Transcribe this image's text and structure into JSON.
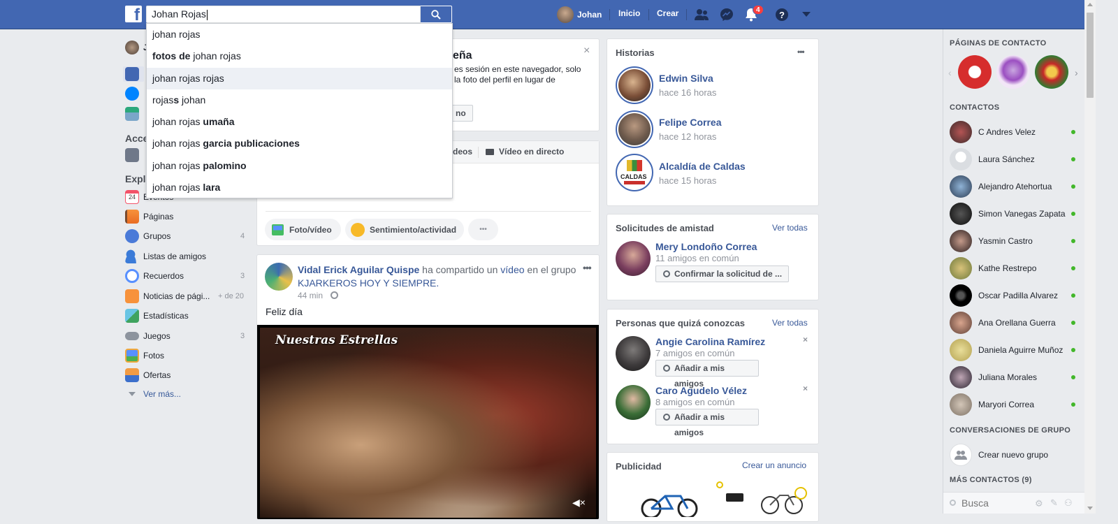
{
  "topbar": {
    "logo": "f",
    "search_value": "Johan Rojas",
    "user_name": "Johan",
    "home": "Inicio",
    "create": "Crear",
    "notifications_count": "4"
  },
  "suggestions": [
    {
      "plain": "johan rojas",
      "bold_prefix": "",
      "bold": ""
    },
    {
      "bold_prefix": "fotos de",
      "plain": " johan rojas",
      "bold": ""
    },
    {
      "plain": "johan rojas rojas",
      "bold_prefix": "",
      "bold": ""
    },
    {
      "plain": "rojas",
      "bold": "s",
      "tail": " johan"
    },
    {
      "plain": "johan rojas ",
      "bold": "umaña"
    },
    {
      "plain": "johan rojas ",
      "bold": "garcia publicaciones"
    },
    {
      "plain": "johan rojas ",
      "bold": "palomino"
    },
    {
      "plain": "johan rojas ",
      "bold": "lara"
    }
  ],
  "left_nav": {
    "user_initial": "J",
    "acce": "Acce",
    "explo": "Explo",
    "items": [
      {
        "label": "Eventos",
        "count": ""
      },
      {
        "label": "Páginas",
        "count": ""
      },
      {
        "label": "Grupos",
        "count": "4"
      },
      {
        "label": "Listas de amigos",
        "count": ""
      },
      {
        "label": "Recuerdos",
        "count": "3"
      },
      {
        "label": "Noticias de pági...",
        "count": "+ de 20"
      },
      {
        "label": "Estadísticas",
        "count": ""
      },
      {
        "label": "Juegos",
        "count": "3"
      },
      {
        "label": "Fotos",
        "count": ""
      },
      {
        "label": "Ofertas",
        "count": ""
      }
    ],
    "see_more": "Ver más..."
  },
  "center": {
    "password_card": {
      "title_tail": "eña",
      "body_line1": "es sesión en este navegador, solo",
      "body_line2": "la foto del perfil en lugar de",
      "button_tail": "no"
    },
    "composer": {
      "tab_videos": "deos",
      "tab_live": "Vídeo en directo",
      "photo_video": "Foto/vídeo",
      "feeling": "Sentimiento/actividad",
      "more": "•••"
    },
    "post": {
      "author": "Vidal Erick Aguilar Quispe",
      "action": " ha compartido un ",
      "video_word": "vídeo",
      "in_group": " en el grupo",
      "group": "KJARKEROS HOY Y SIEMPRE.",
      "time": "44 min",
      "text": "Feliz día",
      "video_title": "Nuestras Estrellas"
    }
  },
  "stories": {
    "title": "Historias",
    "items": [
      {
        "name": "Edwin Silva",
        "time": "hace 16 horas"
      },
      {
        "name": "Felipe Correa",
        "time": "hace 12 horas"
      },
      {
        "name": "Alcaldía de Caldas",
        "time": "hace 15 horas"
      }
    ],
    "caldas_logo": "CALDAS"
  },
  "friend_requests": {
    "title": "Solicitudes de amistad",
    "see_all": "Ver todas",
    "name": "Mery Londoño Correa",
    "mutual": "11 amigos en común",
    "button": "Confirmar la solicitud de ..."
  },
  "people_you_may_know": {
    "title": "Personas que quizá conozcas",
    "see_all": "Ver todas",
    "items": [
      {
        "name": "Angie Carolina Ramírez",
        "mutual": "7 amigos en común",
        "button": "Añadir a mis amigos"
      },
      {
        "name": "Caro Agudelo Vélez",
        "mutual": "8 amigos en común",
        "button": "Añadir a mis amigos"
      }
    ]
  },
  "ads": {
    "title": "Publicidad",
    "create": "Crear un anuncio"
  },
  "chat": {
    "pages_title": "PÁGINAS DE CONTACTO",
    "contacts_title": "CONTACTOS",
    "contacts": [
      "C Andres Velez",
      "Laura Sánchez",
      "Alejandro Atehortua",
      "Simon Vanegas Zapata",
      "Yasmin Castro",
      "Kathe Restrepo",
      "Oscar Padilla Alvarez",
      "Ana Orellana Guerra",
      "Daniela Aguirre Muñoz",
      "Juliana Morales",
      "Maryori Correa"
    ],
    "group_title": "CONVERSACIONES DE GRUPO",
    "new_group": "Crear nuevo grupo",
    "more_contacts": "MÁS CONTACTOS (9)",
    "search_placeholder": "Busca"
  }
}
